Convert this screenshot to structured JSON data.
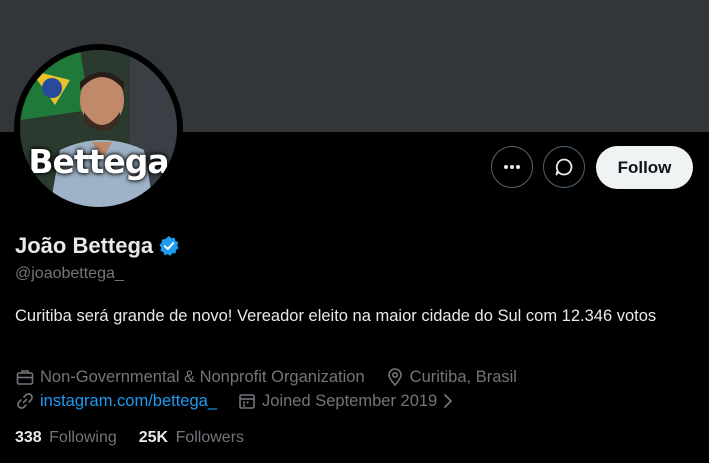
{
  "profile": {
    "name": "João Bettega",
    "handle": "@joaobettega_",
    "bio": "Curitiba será grande de novo! Vereador eleito na maior cidade do Sul com 12.346 votos",
    "avatar_text": "Bettega",
    "verified": true
  },
  "actions": {
    "more_icon": "more-horizontal-icon",
    "message_icon": "message-icon",
    "follow_label": "Follow"
  },
  "meta": {
    "category": "Non-Governmental & Nonprofit Organization",
    "location": "Curitiba, Brasil",
    "website": "instagram.com/bettega_",
    "joined": "Joined September 2019"
  },
  "stats": {
    "following_count": "338",
    "following_label": "Following",
    "followers_count": "25K",
    "followers_label": "Followers"
  },
  "colors": {
    "background": "#000000",
    "banner": "#333639",
    "accent": "#1d9bf0",
    "secondary_text": "#71767b",
    "primary_text": "#e7e9ea"
  }
}
